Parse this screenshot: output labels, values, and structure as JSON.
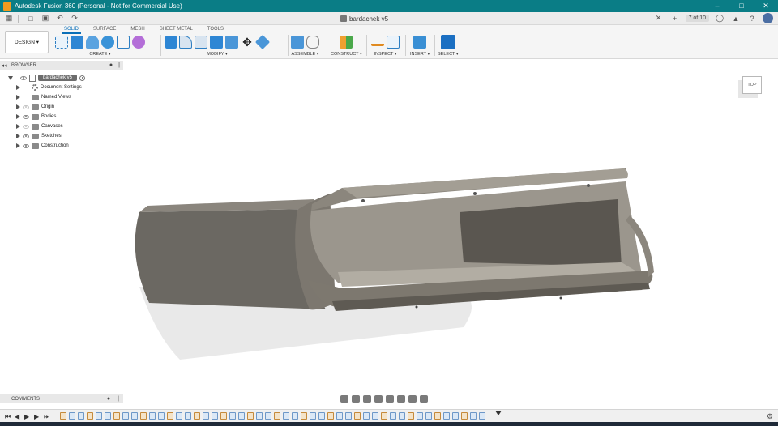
{
  "window": {
    "title": "Autodesk Fusion 360 (Personal - Not for Commercial Use)",
    "document_tab": "bardachek v5",
    "job_count": "7 of 10"
  },
  "ribbon": {
    "workspace": "DESIGN",
    "tabs": [
      {
        "label": "SOLID",
        "active": true
      },
      {
        "label": "SURFACE",
        "active": false
      },
      {
        "label": "MESH",
        "active": false
      },
      {
        "label": "SHEET METAL",
        "active": false
      },
      {
        "label": "TOOLS",
        "active": false
      }
    ],
    "groups": {
      "create": "CREATE",
      "modify": "MODIFY",
      "assemble": "ASSEMBLE",
      "construct": "CONSTRUCT",
      "inspect": "INSPECT",
      "insert": "INSERT",
      "select": "SELECT"
    }
  },
  "browser": {
    "header": "BROWSER",
    "root": "bardachek v5",
    "items": [
      {
        "label": "Document Settings",
        "icon": "gear-icon"
      },
      {
        "label": "Named Views",
        "icon": "folder-icon"
      },
      {
        "label": "Origin",
        "icon": "folder-icon",
        "visible": false
      },
      {
        "label": "Bodies",
        "icon": "folder-icon",
        "visible": true
      },
      {
        "label": "Canvases",
        "icon": "folder-icon",
        "visible": false
      },
      {
        "label": "Sketches",
        "icon": "folder-icon",
        "visible": true
      },
      {
        "label": "Construction",
        "icon": "folder-icon",
        "visible": true
      }
    ]
  },
  "viewcube": {
    "face": "TOP"
  },
  "comments": {
    "label": "COMMENTS"
  },
  "colors": {
    "accent": "#0a7d86",
    "active_tab": "#0a6fb8",
    "model": "#6f6a62"
  }
}
